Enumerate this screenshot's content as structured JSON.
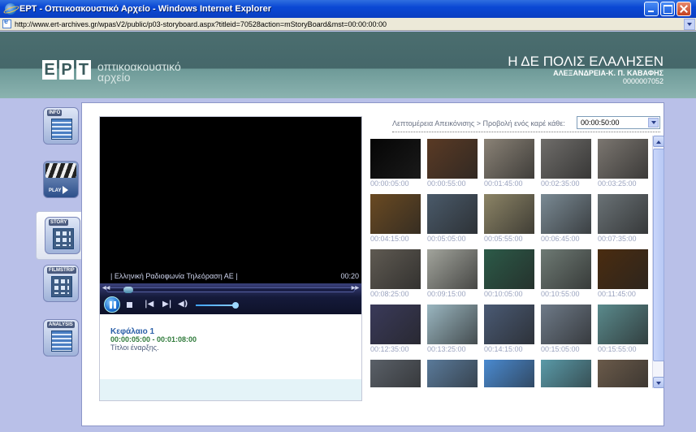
{
  "window": {
    "title": "ΕΡΤ - Οπτικοακουστικό Αρχείο - Windows Internet Explorer",
    "url": "http://www.ert-archives.gr/wpasV2/public/p03-storyboard.aspx?titleid=70528action=mStoryBoard&mst=00:00:00:00"
  },
  "header": {
    "logo_letters": [
      "Ε",
      "Ρ",
      "Τ"
    ],
    "logo_line1": "οπτικοακουστικό",
    "logo_line2": "αρχείο",
    "title": "Η ΔΕ ΠΟΛΙΣ ΕΛΑΛΗΣΕΝ",
    "subtitle": "ΑΛΕΞΑΝΔΡΕΙΑ-Κ. Π. ΚΑΒΑΦΗΣ",
    "code": "0000007052"
  },
  "nav": {
    "info": "INFO",
    "play": "PLAY",
    "story": "STORY",
    "filmstrip": "FILMSTRIP",
    "analysis": "ANALYSIS"
  },
  "player": {
    "caption": "| Ελληνική Ραδιοφωνία Τηλεόραση ΑΕ |",
    "time": "00:20",
    "progress": 0.07,
    "volume": 0.9
  },
  "chapter": {
    "title": "Κεφάλαιο 1",
    "range": "00:00:05:00 - 00:01:08:00",
    "description": "Τίτλοι έναρξης."
  },
  "storyboard": {
    "breadcrumb": "Λεπτομέρεια Απεικόνισης > Προβολή ενός καρέ κάθε:",
    "interval": "00:00:50:00",
    "thumbnails": [
      {
        "time": "00:00:05:00",
        "color": "#050505"
      },
      {
        "time": "00:00:55:00",
        "color": "#5a3a24"
      },
      {
        "time": "00:01:45:00",
        "color": "#8a8276"
      },
      {
        "time": "00:02:35:00",
        "color": "#6f6d6a"
      },
      {
        "time": "00:03:25:00",
        "color": "#7b7670"
      },
      {
        "time": "00:04:15:00",
        "color": "#6a4a22"
      },
      {
        "time": "00:05:05:00",
        "color": "#4a5a6a"
      },
      {
        "time": "00:05:55:00",
        "color": "#8c8466"
      },
      {
        "time": "00:06:45:00",
        "color": "#7a8a94"
      },
      {
        "time": "00:07:35:00",
        "color": "#6a7276"
      },
      {
        "time": "00:08:25:00",
        "color": "#5f5a52"
      },
      {
        "time": "00:09:15:00",
        "color": "#a2a49c"
      },
      {
        "time": "00:10:05:00",
        "color": "#2c5a48"
      },
      {
        "time": "00:10:55:00",
        "color": "#6e7a74"
      },
      {
        "time": "00:11:45:00",
        "color": "#4a2c10"
      },
      {
        "time": "00:12:35:00",
        "color": "#3a3a5a"
      },
      {
        "time": "00:13:25:00",
        "color": "#9ab6c0"
      },
      {
        "time": "00:14:15:00",
        "color": "#4a5a74"
      },
      {
        "time": "00:15:05:00",
        "color": "#6e7a88"
      },
      {
        "time": "00:15:55:00",
        "color": "#5a8a8c"
      },
      {
        "time": "",
        "color": "#5a6068"
      },
      {
        "time": "",
        "color": "#5a7a9a"
      },
      {
        "time": "",
        "color": "#4a8ad0"
      },
      {
        "time": "",
        "color": "#5a9aa8"
      },
      {
        "time": "",
        "color": "#6a5a4a"
      }
    ]
  }
}
